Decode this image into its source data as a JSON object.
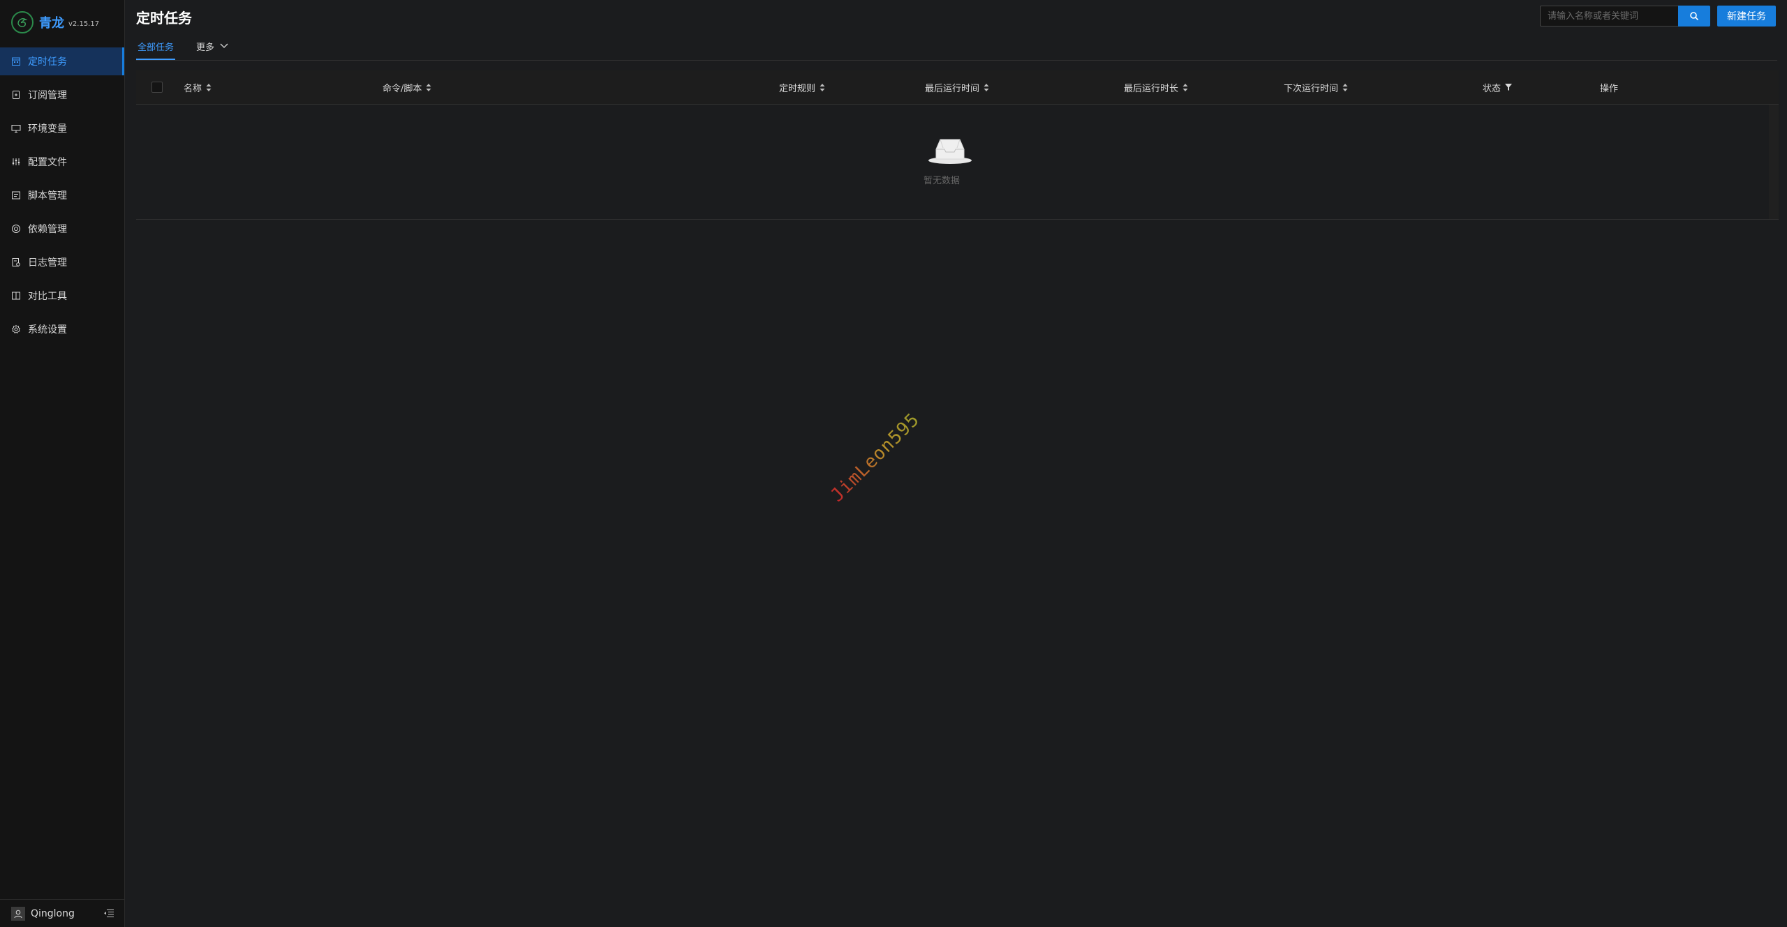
{
  "app": {
    "title": "青龙",
    "version": "v2.15.17"
  },
  "sidebar": {
    "items": [
      {
        "label": "定时任务",
        "icon": "calendar-icon",
        "active": true
      },
      {
        "label": "订阅管理",
        "icon": "subscription-icon",
        "active": false
      },
      {
        "label": "环境变量",
        "icon": "desktop-icon",
        "active": false
      },
      {
        "label": "配置文件",
        "icon": "sliders-icon",
        "active": false
      },
      {
        "label": "脚本管理",
        "icon": "script-icon",
        "active": false
      },
      {
        "label": "依赖管理",
        "icon": "dependency-icon",
        "active": false
      },
      {
        "label": "日志管理",
        "icon": "log-icon",
        "active": false
      },
      {
        "label": "对比工具",
        "icon": "diff-icon",
        "active": false
      },
      {
        "label": "系统设置",
        "icon": "settings-icon",
        "active": false
      }
    ],
    "user": "Qinglong"
  },
  "header": {
    "title": "定时任务",
    "search_placeholder": "请输入名称或者关键词",
    "new_button": "新建任务"
  },
  "tabs": [
    {
      "label": "全部任务",
      "active": true
    },
    {
      "label": "更多",
      "active": false
    }
  ],
  "table": {
    "columns": [
      "名称",
      "命令/脚本",
      "定时规则",
      "最后运行时间",
      "最后运行时长",
      "下次运行时间",
      "状态",
      "操作"
    ],
    "rows": [],
    "empty_text": "暂无数据"
  },
  "watermark": "JimLeon595",
  "colors": {
    "accent": "#177ddc",
    "background": "#1b1c1e",
    "sidebar": "#141414"
  }
}
